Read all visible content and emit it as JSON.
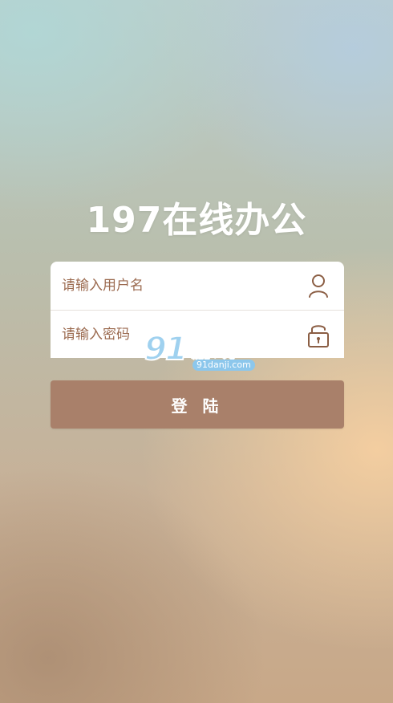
{
  "app": {
    "title": "197在线办公"
  },
  "form": {
    "username": {
      "placeholder": "请输入用户名",
      "value": "",
      "icon": "user-icon"
    },
    "password": {
      "placeholder": "请输入密码",
      "value": "",
      "icon": "unlock-icon"
    }
  },
  "actions": {
    "login_label": "登 陆"
  },
  "watermark": {
    "logo_number": "91",
    "logo_text": "游戏",
    "site": "91danji.com"
  },
  "colors": {
    "accent": "#a9806a",
    "icon": "#8b5e44",
    "placeholder": "#9b6a4f",
    "title": "#ffffff"
  }
}
